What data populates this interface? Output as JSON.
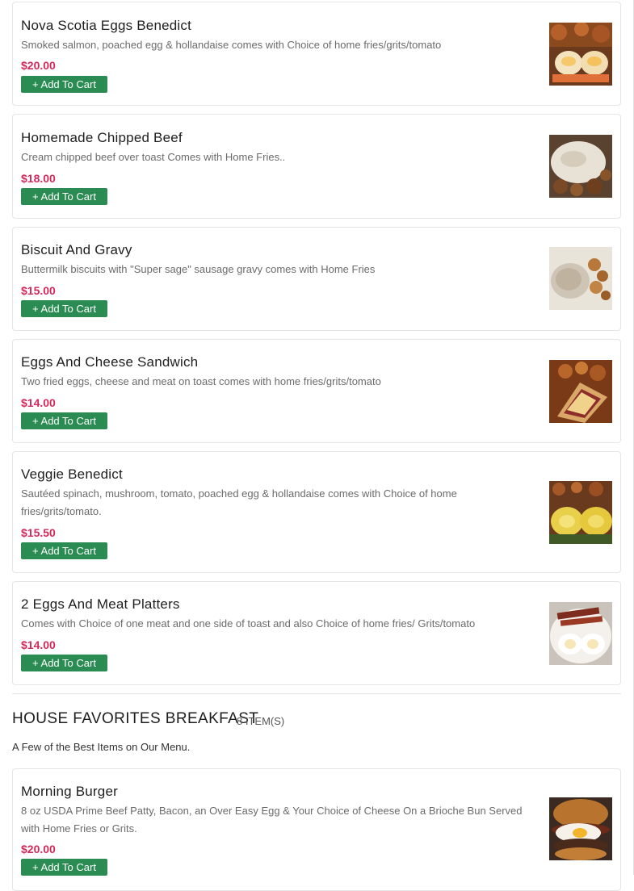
{
  "menu_items": [
    {
      "name": "Nova Scotia Eggs Benedict",
      "description": "Smoked salmon, poached egg & hollandaise comes with Choice of home fries/grits/tomato",
      "price": "$20.00",
      "button_label": "+ Add To Cart"
    },
    {
      "name": "Homemade Chipped Beef",
      "description": "Cream chipped beef over toast Comes with Home Fries..",
      "price": "$18.00",
      "button_label": "+ Add To Cart"
    },
    {
      "name": "Biscuit And Gravy",
      "description": "Buttermilk biscuits with \"Super sage\" sausage gravy comes with Home Fries",
      "price": "$15.00",
      "button_label": "+ Add To Cart"
    },
    {
      "name": "Eggs And Cheese Sandwich",
      "description": "Two fried eggs, cheese and meat on toast comes with home fries/grits/tomato",
      "price": "$14.00",
      "button_label": "+ Add To Cart"
    },
    {
      "name": "Veggie Benedict",
      "description": "Sautéed spinach, mushroom, tomato, poached egg & hollandaise comes with Choice of home fries/grits/tomato.",
      "price": "$15.50",
      "button_label": "+ Add To Cart"
    },
    {
      "name": "2 Eggs And Meat Platters",
      "description": "Comes with Choice of one meat and one side of toast and also Choice of home fries/ Grits/tomato",
      "price": "$14.00",
      "button_label": "+ Add To Cart"
    }
  ],
  "section": {
    "title": "HOUSE FAVORITES BREAKFAST",
    "count": "8 ITEM(S)",
    "description": "A Few of the Best Items on Our Menu."
  },
  "section_items": [
    {
      "name": "Morning Burger",
      "description": "8 oz USDA Prime Beef Patty, Bacon, an Over Easy Egg & Your Choice of Cheese On a Brioche Bun Served with Home Fries or Grits.",
      "price": "$20.00",
      "button_label": "+ Add To Cart"
    }
  ],
  "colors": {
    "price": "#d2285a",
    "add_button": "#2a8c52",
    "border": "#e6e6e6"
  }
}
